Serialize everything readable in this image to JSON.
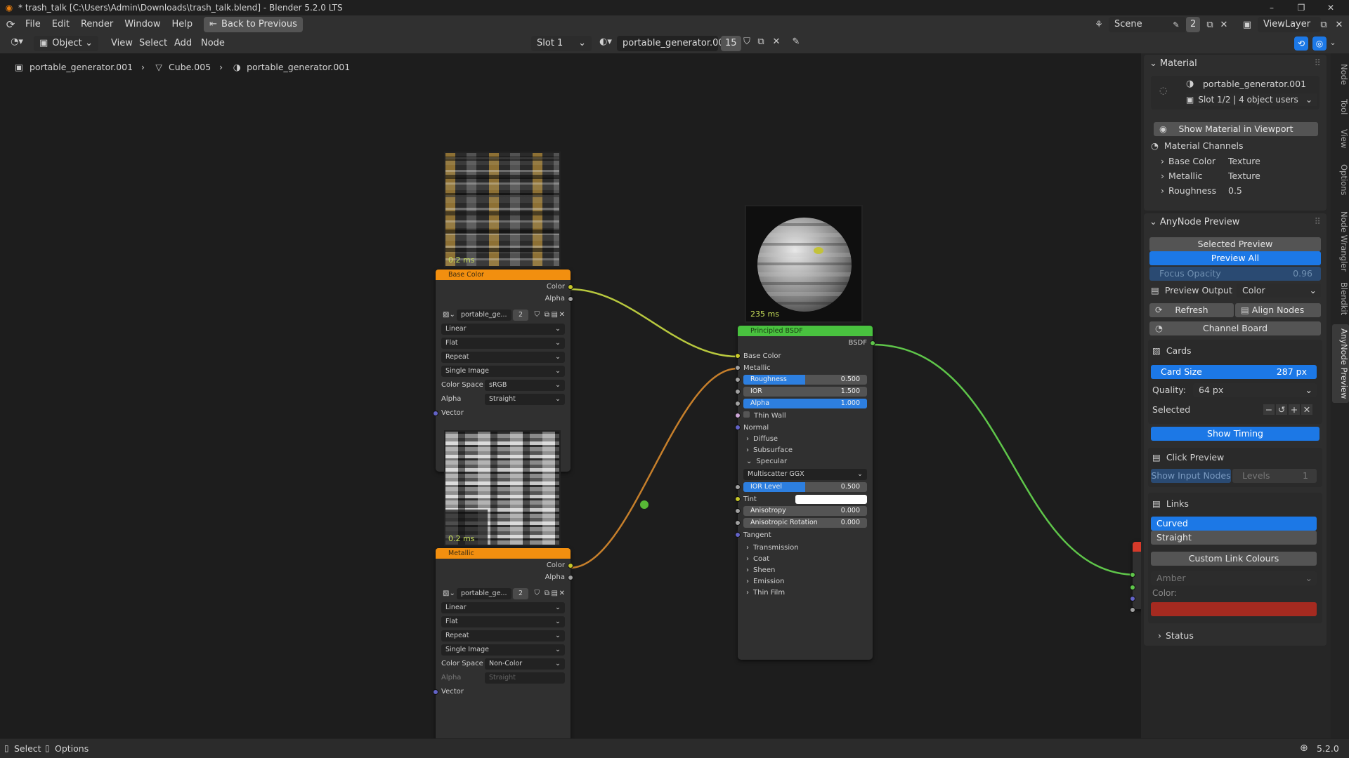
{
  "title": "* trash_talk [C:\\Users\\Admin\\Downloads\\trash_talk.blend] - Blender 5.2.0 LTS",
  "menu": [
    "File",
    "Edit",
    "Render",
    "Window",
    "Help"
  ],
  "back_to_previous": "Back to Previous",
  "scene": {
    "name": "Scene",
    "users": "2",
    "view_layer": "ViewLayer"
  },
  "header": {
    "mode": "Object",
    "items": [
      "View",
      "Select",
      "Add",
      "Node"
    ],
    "slot": "Slot 1",
    "material": "portable_generator.001",
    "users": "15"
  },
  "breadcrumb": [
    "portable_generator.001",
    "Cube.005",
    "portable_generator.001"
  ],
  "nodes": {
    "base_color": {
      "timing": "0.2 ms",
      "title": "Base Color",
      "out_color": "Color",
      "out_alpha": "Alpha",
      "image": "portable_ge...",
      "image_users": "2",
      "interp": "Linear",
      "projection": "Flat",
      "extension": "Repeat",
      "source": "Single Image",
      "colorspace_label": "Color Space",
      "colorspace": "sRGB",
      "alpha_label": "Alpha",
      "alpha": "Straight",
      "vector": "Vector"
    },
    "metallic": {
      "timing": "0.2 ms",
      "title": "Metallic",
      "out_color": "Color",
      "out_alpha": "Alpha",
      "image": "portable_ge...",
      "image_users": "2",
      "interp": "Linear",
      "projection": "Flat",
      "extension": "Repeat",
      "source": "Single Image",
      "colorspace_label": "Color Space",
      "colorspace": "Non-Color",
      "alpha_label": "Alpha",
      "alpha": "Straight",
      "vector": "Vector"
    },
    "bsdf": {
      "timing": "235 ms",
      "title": "Principled BSDF",
      "out": "BSDF",
      "base_color": "Base Color",
      "metallic": "Metallic",
      "roughness": {
        "label": "Roughness",
        "value": "0.500",
        "fraction": 0.5
      },
      "ior": {
        "label": "IOR",
        "value": "1.500",
        "fraction": 0.0
      },
      "alpha": {
        "label": "Alpha",
        "value": "1.000",
        "fraction": 1.0
      },
      "thin_wall": "Thin Wall",
      "normal": "Normal",
      "diffuse": "Diffuse",
      "subsurface": "Subsurface",
      "specular": "Specular",
      "distribution": "Multiscatter GGX",
      "ior_level": {
        "label": "IOR Level",
        "value": "0.500",
        "fraction": 0.5
      },
      "tint": "Tint",
      "anisotropy": {
        "label": "Anisotropy",
        "value": "0.000",
        "fraction": 0.0
      },
      "aniso_rot": {
        "label": "Anisotropic Rotation",
        "value": "0.000",
        "fraction": 0.0
      },
      "tangent": "Tangent",
      "panels": [
        "Transmission",
        "Coat",
        "Sheen",
        "Emission",
        "Thin Film"
      ]
    }
  },
  "sidebar": {
    "material": {
      "header": "Material",
      "name": "portable_generator.001",
      "slot": "Slot 1/2 | 4 object users",
      "show_btn": "Show Material in Viewport",
      "channels_header": "Material Channels",
      "channels": [
        {
          "name": "Base Color",
          "value": "Texture"
        },
        {
          "name": "Metallic",
          "value": "Texture"
        },
        {
          "name": "Roughness",
          "value": "0.5"
        }
      ]
    },
    "anynode": {
      "header": "AnyNode Preview",
      "selected_preview": "Selected Preview",
      "preview_all": "Preview All",
      "focus_opacity": {
        "label": "Focus Opacity",
        "value": "0.96"
      },
      "preview_output": {
        "label": "Preview Output",
        "value": "Color"
      },
      "refresh": "Refresh",
      "align_nodes": "Align Nodes",
      "channel_board": "Channel Board",
      "cards_header": "Cards",
      "card_size": {
        "label": "Card Size",
        "value": "287 px"
      },
      "quality": {
        "label": "Quality:",
        "value": "64 px"
      },
      "selected": "Selected",
      "show_timing": "Show Timing",
      "click_preview_header": "Click Preview",
      "show_input_nodes": "Show Input Nodes",
      "levels": {
        "label": "Levels",
        "value": "1"
      },
      "links_header": "Links",
      "curved": "Curved",
      "straight": "Straight",
      "custom_link_colours": "Custom Link Colours",
      "amber": "Amber",
      "color_label": "Color:",
      "link_color": "#a52a20",
      "status": "Status"
    }
  },
  "side_tabs": [
    "Node",
    "Tool",
    "View",
    "Options",
    "Node Wrangler",
    "Blendkit",
    "AnyNode Preview"
  ],
  "statusbar": {
    "select": "Select",
    "options": "Options",
    "version": "5.2.0"
  }
}
